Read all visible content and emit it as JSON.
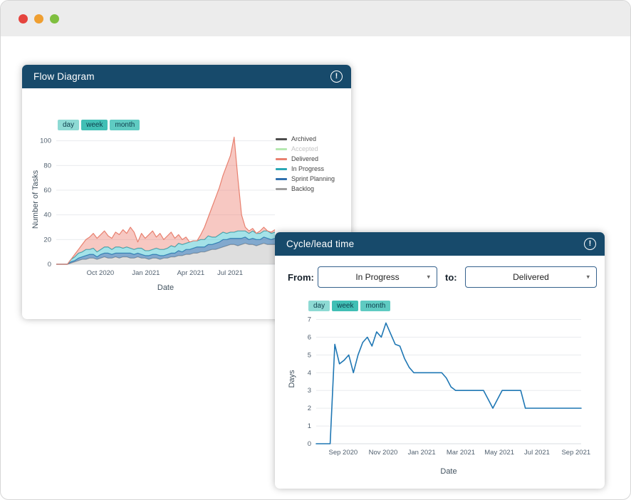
{
  "window": {
    "traffic_lights": [
      {
        "name": "close",
        "color": "#e5443e"
      },
      {
        "name": "minimize",
        "color": "#ef9f31"
      },
      {
        "name": "zoom",
        "color": "#7fbf3f"
      }
    ]
  },
  "flow_card": {
    "title": "Flow Diagram",
    "alert_icon": "!",
    "toggles": [
      {
        "label": "day",
        "selected": false,
        "color": "#8edad4"
      },
      {
        "label": "week",
        "selected": true,
        "color": "#41bfb5"
      },
      {
        "label": "month",
        "selected": false,
        "color": "#5fcbc2"
      }
    ]
  },
  "cycle_card": {
    "title": "Cycle/lead time",
    "alert_icon": "!",
    "from_label": "From:",
    "to_label": "to:",
    "from_value": "In Progress",
    "to_value": "Delivered",
    "toggles": [
      {
        "label": "day",
        "selected": false,
        "color": "#8edad4"
      },
      {
        "label": "week",
        "selected": true,
        "color": "#41bfb5"
      },
      {
        "label": "month",
        "selected": false,
        "color": "#5fcbc2"
      }
    ]
  },
  "chart_data": [
    {
      "type": "area",
      "stacked": true,
      "title": "Flow Diagram",
      "xlabel": "Date",
      "ylabel": "Number of Tasks",
      "ylim": [
        0,
        105
      ],
      "yticks": [
        0,
        20,
        40,
        60,
        80,
        100
      ],
      "xticklabels": [
        "Oct 2020",
        "Jan 2021",
        "Apr 2021",
        "Jul 2021"
      ],
      "xtick_positions": [
        11.9,
        24.2,
        36.3,
        46.9
      ],
      "x_unit": "week-index",
      "grid": "horizontal",
      "legend_position": "right",
      "series": [
        {
          "name": "Backlog",
          "color": "#9e9e9e",
          "fill": "rgba(189,189,189,0.5)",
          "hidden": false,
          "values": [
            0,
            0,
            0,
            0,
            1,
            2,
            3,
            4,
            4,
            5,
            5,
            4,
            5,
            6,
            5,
            5,
            6,
            5,
            6,
            6,
            5,
            5,
            6,
            5,
            5,
            4,
            5,
            5,
            4,
            5,
            5,
            6,
            6,
            7,
            7,
            8,
            8,
            9,
            9,
            10,
            10,
            11,
            12,
            12,
            13,
            14,
            15,
            16,
            16,
            15,
            16,
            17,
            16,
            16,
            15,
            16,
            17,
            16,
            16,
            16
          ]
        },
        {
          "name": "Sprint Planning",
          "color": "#2f6fad",
          "fill": "rgba(47,111,173,0.6)",
          "hidden": false,
          "values": [
            0,
            0,
            0,
            0,
            1,
            1,
            2,
            2,
            3,
            3,
            3,
            2,
            3,
            3,
            4,
            3,
            3,
            4,
            3,
            3,
            4,
            3,
            3,
            3,
            2,
            3,
            3,
            3,
            3,
            2,
            3,
            3,
            3,
            4,
            3,
            4,
            4,
            4,
            5,
            4,
            4,
            5,
            4,
            5,
            5,
            6,
            5,
            5,
            5,
            6,
            5,
            5,
            4,
            5,
            5,
            4,
            5,
            5,
            4,
            5
          ]
        },
        {
          "name": "In Progress",
          "color": "#2ba8b5",
          "fill": "rgba(74,198,210,0.5)",
          "hidden": false,
          "values": [
            0,
            0,
            0,
            0,
            2,
            3,
            4,
            4,
            5,
            4,
            5,
            4,
            4,
            5,
            5,
            4,
            5,
            5,
            4,
            5,
            4,
            4,
            4,
            5,
            4,
            4,
            4,
            5,
            5,
            5,
            5,
            6,
            5,
            6,
            6,
            5,
            6,
            6,
            5,
            6,
            6,
            7,
            6,
            5,
            6,
            6,
            5,
            5,
            5,
            6,
            6,
            5,
            5,
            6,
            5,
            5,
            5,
            6,
            5,
            5
          ]
        },
        {
          "name": "Delivered",
          "color": "#e8806f",
          "fill": "rgba(238,134,119,0.45)",
          "hidden": false,
          "values": [
            0,
            0,
            0,
            0,
            0,
            2,
            3,
            6,
            8,
            10,
            12,
            11,
            12,
            13,
            9,
            9,
            12,
            10,
            15,
            11,
            17,
            14,
            5,
            12,
            10,
            13,
            15,
            9,
            13,
            8,
            10,
            11,
            7,
            7,
            4,
            5,
            0,
            0,
            0,
            4,
            10,
            15,
            24,
            32,
            38,
            46,
            55,
            62,
            77,
            43,
            13,
            3,
            2,
            2,
            0,
            2,
            3,
            0,
            1,
            2
          ]
        },
        {
          "name": "Accepted",
          "color": "#b5e8b0",
          "fill": "rgba(181,232,176,0.5)",
          "hidden": true,
          "values": [
            0,
            0,
            0,
            0,
            0,
            0,
            0,
            0,
            0,
            0,
            0,
            0,
            0,
            0,
            0,
            0,
            0,
            0,
            0,
            0,
            0,
            0,
            0,
            0,
            0,
            0,
            0,
            0,
            0,
            0,
            0,
            0,
            0,
            0,
            0,
            0,
            0,
            0,
            0,
            0,
            0,
            0,
            0,
            0,
            0,
            0,
            0,
            0,
            0,
            0,
            0,
            0,
            0,
            0,
            0,
            0,
            0,
            0,
            0,
            0
          ]
        },
        {
          "name": "Archived",
          "color": "#4d4d4d",
          "fill": "rgba(90,90,90,0.5)",
          "hidden": false,
          "values": [
            0,
            0,
            0,
            0,
            0,
            0,
            0,
            0,
            0,
            0,
            0,
            0,
            0,
            0,
            0,
            0,
            0,
            0,
            0,
            0,
            0,
            0,
            0,
            0,
            0,
            0,
            0,
            0,
            0,
            0,
            0,
            0,
            0,
            0,
            0,
            0,
            0,
            0,
            0,
            0,
            0,
            0,
            0,
            0,
            0,
            0,
            0,
            0,
            0,
            0,
            0,
            0,
            0,
            0,
            0,
            0,
            0,
            0,
            0,
            0
          ]
        }
      ]
    },
    {
      "type": "line",
      "title": "Cycle/lead time",
      "xlabel": "Date",
      "ylabel": "Days",
      "ylim": [
        0,
        7.3
      ],
      "yticks": [
        0,
        1,
        2,
        3,
        4,
        5,
        6,
        7
      ],
      "xticklabels": [
        "Sep 2020",
        "Nov 2020",
        "Jan 2021",
        "Mar 2021",
        "May 2021",
        "Jul 2021",
        "Sep 2021"
      ],
      "xtick_positions": [
        5.8,
        14.4,
        22.7,
        31.1,
        39.4,
        47.5,
        55.9
      ],
      "x_unit": "week-index",
      "grid": "horizontal",
      "line_color": "#1f77b4",
      "values": [
        0,
        0,
        0,
        0,
        5.6,
        4.5,
        4.7,
        5.0,
        4.0,
        5.0,
        5.7,
        6.0,
        5.5,
        6.3,
        6.0,
        6.8,
        6.2,
        5.6,
        5.5,
        4.8,
        4.3,
        4.0,
        4.0,
        4.0,
        4.0,
        4.0,
        4.0,
        4.0,
        3.7,
        3.2,
        3.0,
        3.0,
        3.0,
        3.0,
        3.0,
        3.0,
        3.0,
        2.5,
        2.0,
        2.5,
        3.0,
        3.0,
        3.0,
        3.0,
        3.0,
        2.0,
        2.0,
        2.0,
        2.0,
        2.0,
        2.0,
        2.0,
        2.0,
        2.0,
        2.0,
        2.0,
        2.0,
        2.0
      ]
    }
  ]
}
